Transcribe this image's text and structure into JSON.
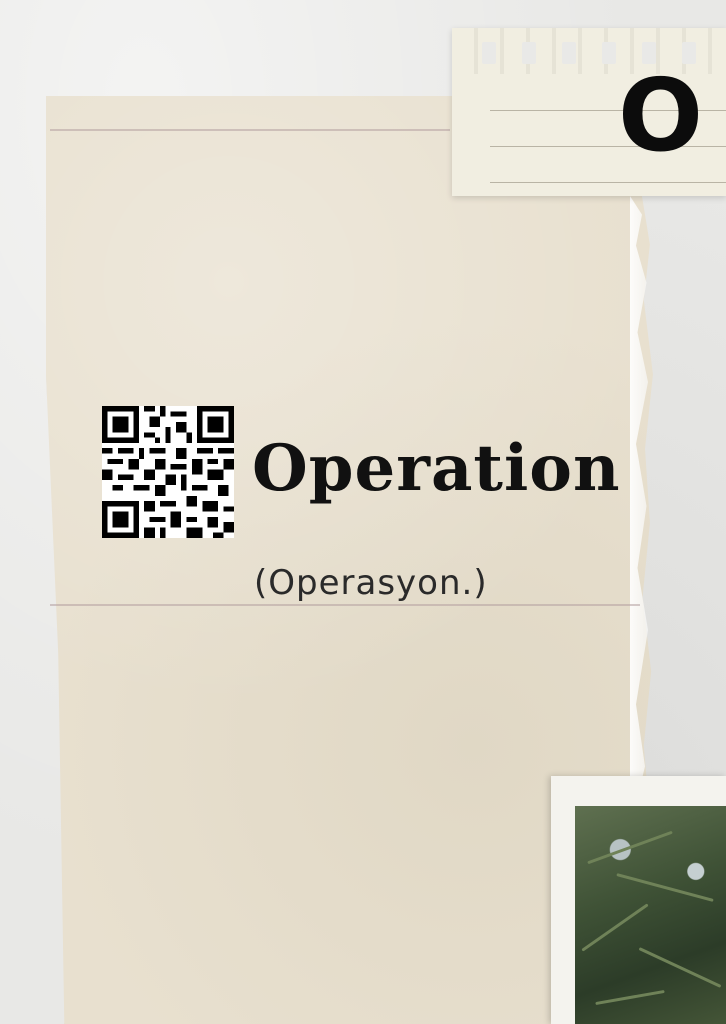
{
  "note": {
    "letter": "O"
  },
  "entry": {
    "title": "Operation",
    "translation": "(Operasyon.)"
  },
  "icons": {
    "qr": "qr-code-icon",
    "photo": "photo-tree-icon"
  },
  "colors": {
    "background": "#e9e9e7",
    "paper": "#e8e0cf",
    "text": "#111111"
  }
}
